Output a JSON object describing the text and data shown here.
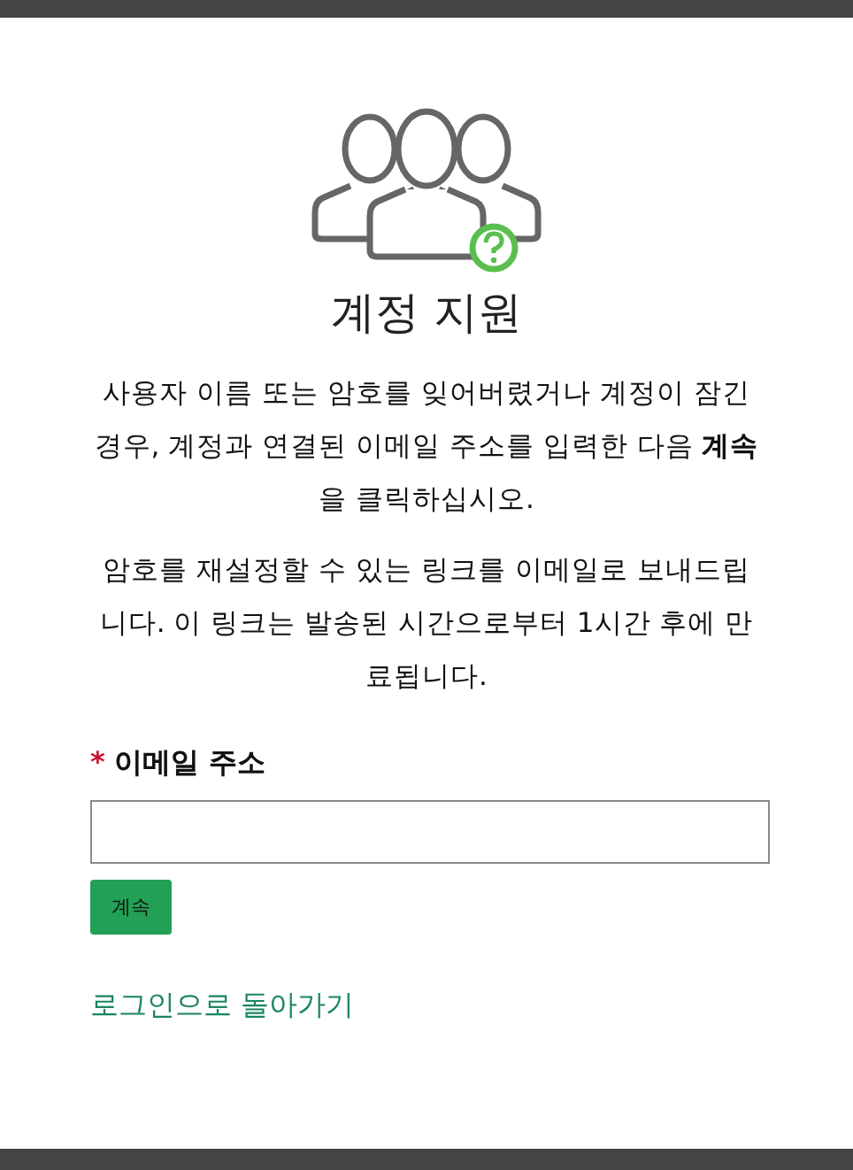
{
  "title": "계정 지원",
  "paragraphs": [
    "사용자 이름 또는 암호를 잊어버렸거나 계정이 잠긴 경우, 계정과 연결된 이메일 주소를 입력한 다음 **계속**을 클릭하십시오.",
    "암호를 재설정할 수 있는 링크를 이메일로 보내드립니다. 이 링크는 발송된 시간으로부터 1시간 후에 만료됩니다."
  ],
  "email_field": {
    "label": "이메일 주소",
    "required_mark": "*",
    "required": true
  },
  "continue_button": "계속",
  "back_link": "로그인으로 돌아가기"
}
